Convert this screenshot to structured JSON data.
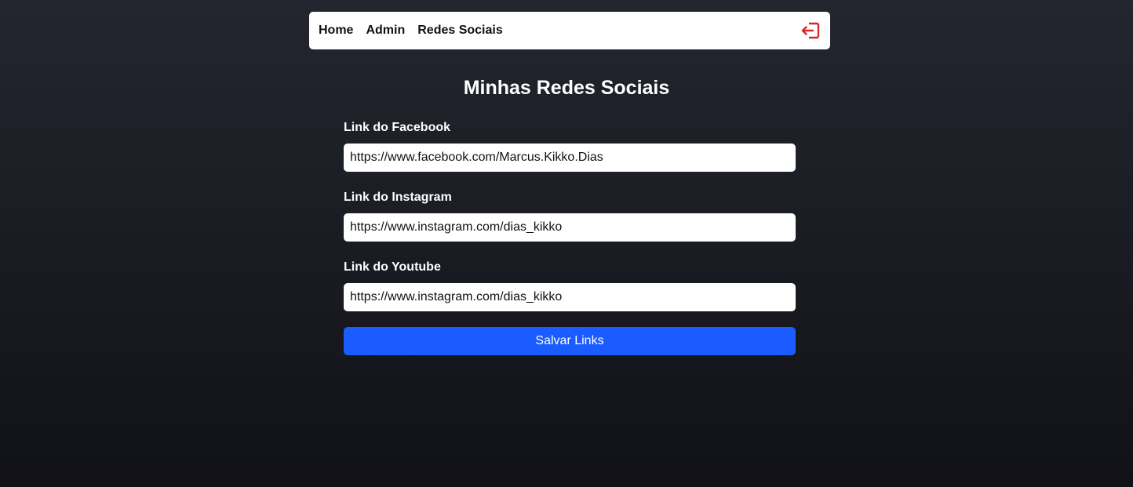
{
  "nav": {
    "links": [
      "Home",
      "Admin",
      "Redes Sociais"
    ],
    "logout_icon": "logout-icon",
    "logout_color": "#d62828"
  },
  "page": {
    "title": "Minhas Redes Sociais"
  },
  "form": {
    "facebook": {
      "label": "Link do Facebook",
      "value": "https://www.facebook.com/Marcus.Kikko.Dias"
    },
    "instagram": {
      "label": "Link do Instagram",
      "value": "https://www.instagram.com/dias_kikko"
    },
    "youtube": {
      "label": "Link do Youtube",
      "value": "https://www.instagram.com/dias_kikko"
    },
    "submit_label": "Salvar Links",
    "submit_color": "#1a5cff"
  }
}
